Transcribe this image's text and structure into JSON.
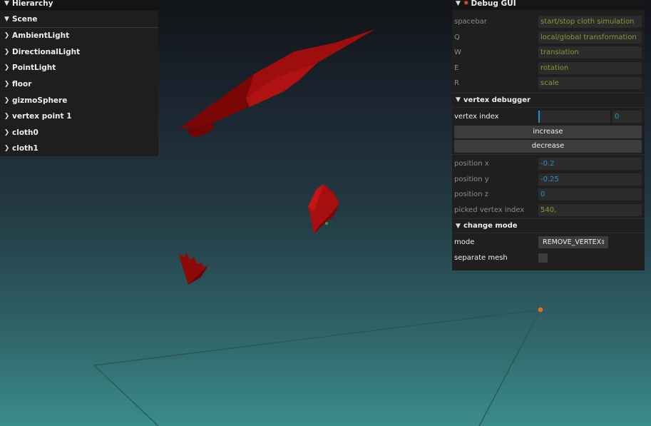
{
  "hierarchy": {
    "title": "Hierarchy",
    "scene_label": "Scene",
    "items": [
      {
        "label": "AmbientLight"
      },
      {
        "label": "DirectionalLight"
      },
      {
        "label": "PointLight"
      },
      {
        "label": "floor"
      },
      {
        "label": "gizmoSphere"
      },
      {
        "label": "vertex point 1"
      },
      {
        "label": "cloth0"
      },
      {
        "label": "cloth1"
      }
    ]
  },
  "debug_gui": {
    "title": "Debug GUI",
    "shortcuts": [
      {
        "key": "spacebar",
        "value": "start/stop cloth simulation"
      },
      {
        "key": "Q",
        "value": "local/global transformation"
      },
      {
        "key": "W",
        "value": "translation"
      },
      {
        "key": "E",
        "value": "rotation"
      },
      {
        "key": "R",
        "value": "scale"
      }
    ],
    "vertex_debugger": {
      "title": "vertex debugger",
      "vertex_index_label": "vertex index",
      "vertex_index_value": "0",
      "increase_label": "increase",
      "decrease_label": "decrease",
      "position_x_label": "position x",
      "position_x_value": "-0.2",
      "position_y_label": "position y",
      "position_y_value": "-0.25",
      "position_z_label": "position z",
      "position_z_value": "0",
      "picked_label": "picked vertex index",
      "picked_value": "540,"
    },
    "change_mode": {
      "title": "change mode",
      "mode_label": "mode",
      "mode_value": "REMOVE_VERTEX",
      "separate_label": "separate mesh",
      "separate_checked": false
    }
  },
  "colors": {
    "cloth": "#8b0a0a",
    "gizmo_point": "#e0701a",
    "number_value": "#2d8bc1",
    "string_value": "#7c9e35"
  }
}
